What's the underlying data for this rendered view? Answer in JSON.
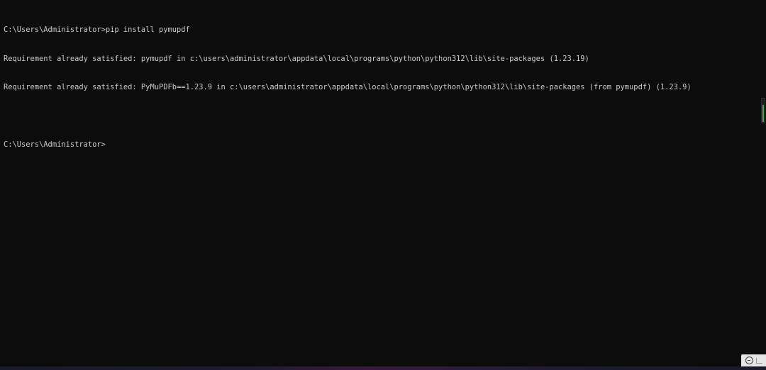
{
  "terminal": {
    "lines": [
      "C:\\Users\\Administrator>pip install pymupdf",
      "Requirement already satisfied: pymupdf in c:\\users\\administrator\\appdata\\local\\programs\\python\\python312\\lib\\site-packages (1.23.19)",
      "Requirement already satisfied: PyMuPDFb==1.23.9 in c:\\users\\administrator\\appdata\\local\\programs\\python\\python312\\lib\\site-packages (from pymupdf) (1.23.9)",
      "",
      "C:\\Users\\Administrator>"
    ]
  },
  "colors": {
    "background": "#0c0c0c",
    "text": "#cccccc",
    "scroll_indicator": "#3cb043"
  },
  "icons": {
    "tray": "zoom-out-icon"
  }
}
